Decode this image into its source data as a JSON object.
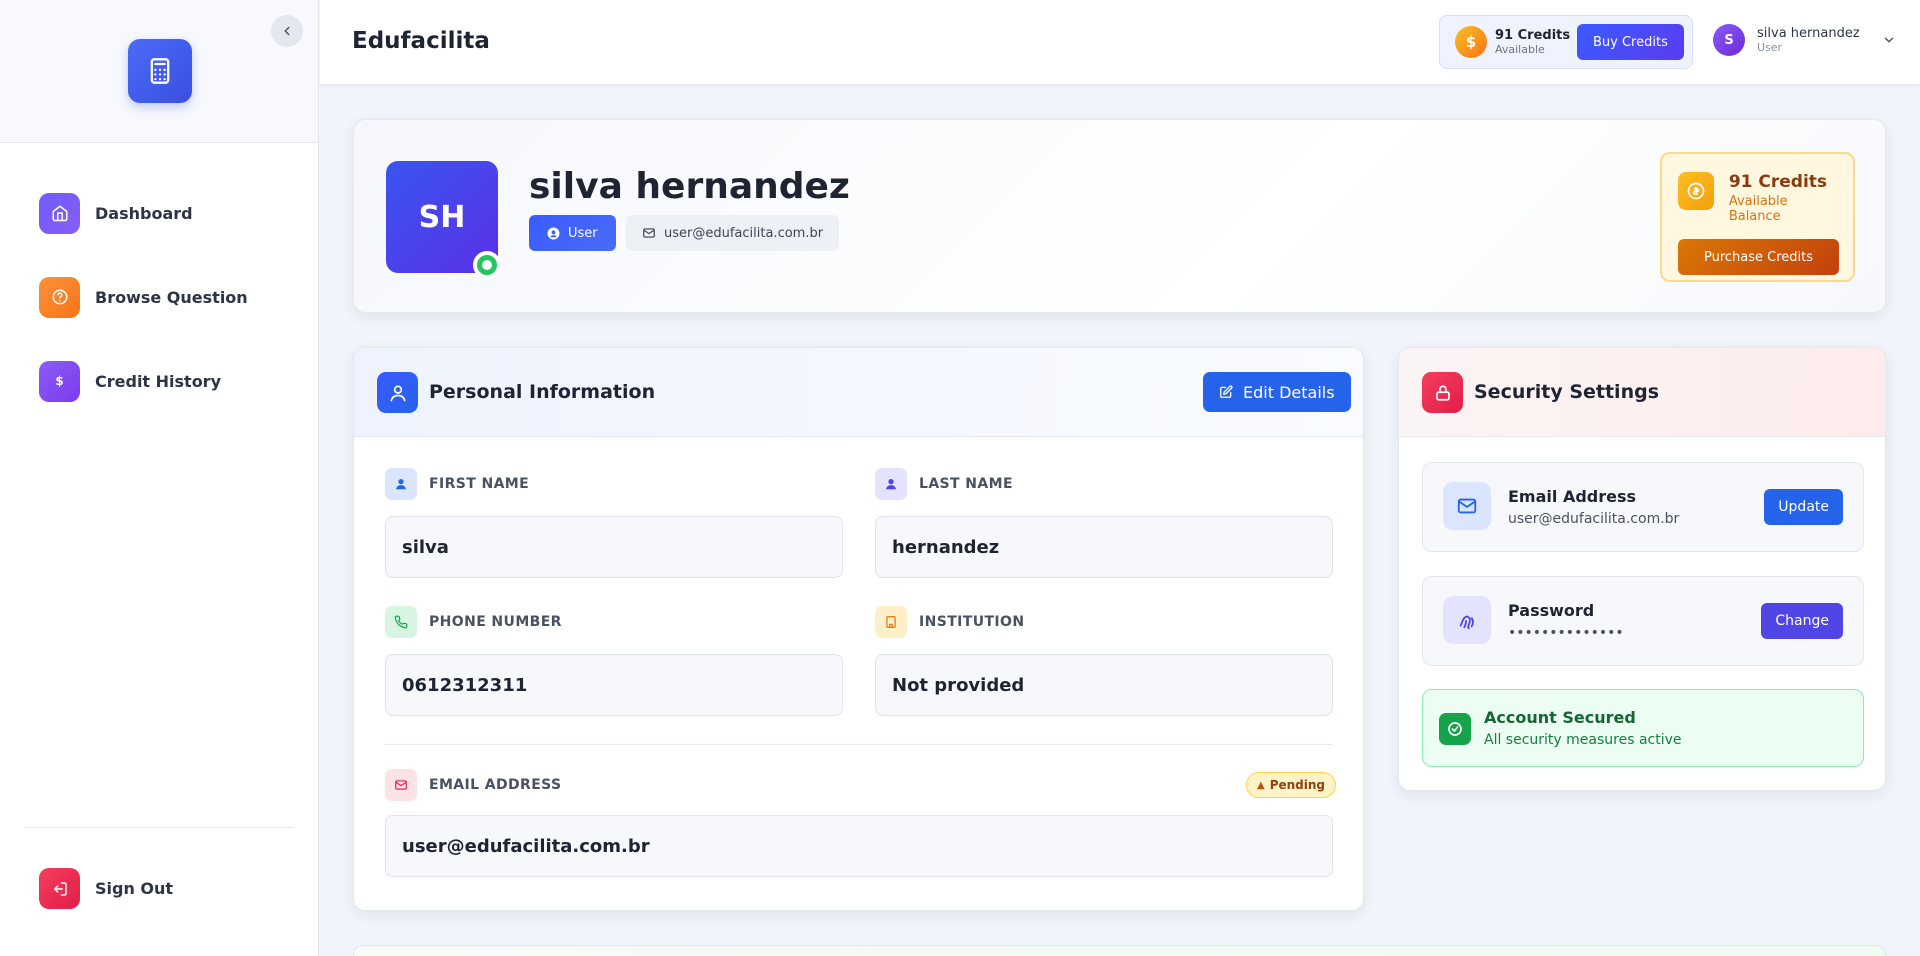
{
  "app": {
    "brand": "Edufacilita"
  },
  "sidebar": {
    "items": [
      {
        "label": "Dashboard",
        "icon": "home-icon",
        "color": "#7c4dff"
      },
      {
        "label": "Browse Question",
        "icon": "help-circle-icon",
        "color": "#f97316"
      },
      {
        "label": "Credit History",
        "icon": "dollar-icon",
        "color": "#8b5cf6"
      }
    ],
    "sign_out": {
      "label": "Sign Out",
      "icon": "logout-icon",
      "color": "#e11d48"
    }
  },
  "header": {
    "credits_count": "91 Credits",
    "credits_status": "Available",
    "buy_label": "Buy Credits",
    "user_initial": "S",
    "user_name": "silva hernandez",
    "user_role": "User"
  },
  "profile": {
    "initials": "SH",
    "name": "silva hernandez",
    "role": "User",
    "email": "user@edufacilita.com.br",
    "balance_title": "91 Credits",
    "balance_sub": "Available Balance",
    "purchase_label": "Purchase Credits"
  },
  "personal": {
    "title": "Personal Information",
    "edit_label": "Edit Details",
    "fields": {
      "first_name": {
        "label": "FIRST NAME",
        "value": "silva"
      },
      "last_name": {
        "label": "LAST NAME",
        "value": "hernandez"
      },
      "phone": {
        "label": "PHONE NUMBER",
        "value": "0612312311"
      },
      "institution": {
        "label": "INSTITUTION",
        "value": "Not provided"
      },
      "email": {
        "label": "EMAIL ADDRESS",
        "value": "user@edufacilita.com.br",
        "status": "Pending"
      }
    }
  },
  "security": {
    "title": "Security Settings",
    "email": {
      "title": "Email Address",
      "value": "user@edufacilita.com.br",
      "button": "Update"
    },
    "password": {
      "title": "Password",
      "value": "••••••••••••••",
      "button": "Change"
    },
    "status": {
      "title": "Account Secured",
      "sub": "All security measures active"
    }
  },
  "colors": {
    "primary": "#2563eb",
    "accent": "#5a3cf0",
    "warning": "#d97706",
    "success": "#16a34a",
    "danger": "#e11d48"
  }
}
